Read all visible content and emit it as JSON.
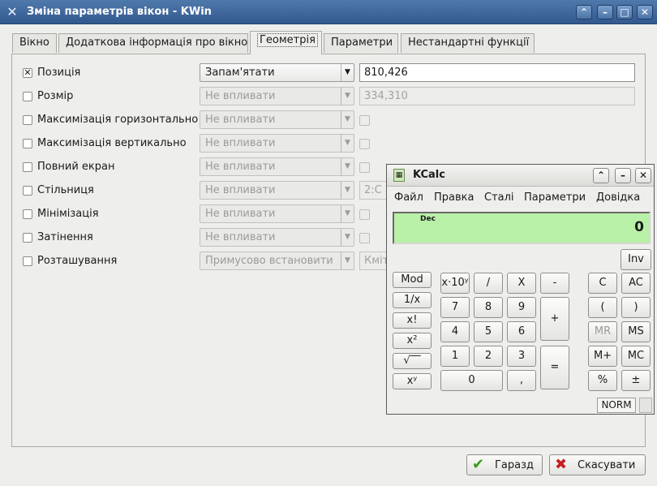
{
  "window": {
    "title": "Зміна параметрів вікон - KWin",
    "buttons": [
      "⌃",
      "–",
      "□",
      "✕"
    ]
  },
  "tabs": [
    {
      "label": "Вікно",
      "active": false
    },
    {
      "label": "Додаткова інформація про вікно",
      "active": false
    },
    {
      "label": "Геометрія",
      "active": true
    },
    {
      "label": "Параметри",
      "active": false
    },
    {
      "label": "Нестандартні функції",
      "active": false
    }
  ],
  "rows": [
    {
      "label": "Позиція",
      "checked": true,
      "select": "Запам'ятати",
      "select_enabled": true,
      "value": "810,426",
      "value_kind": "field"
    },
    {
      "label": "Розмір",
      "checked": false,
      "select": "Не впливати",
      "select_enabled": false,
      "value": "334,310",
      "value_kind": "field-disabled"
    },
    {
      "label": "Максимізація горизонтально",
      "checked": false,
      "select": "Не впливати",
      "select_enabled": false,
      "value_kind": "checkbox"
    },
    {
      "label": "Максимізація вертикально",
      "checked": false,
      "select": "Не впливати",
      "select_enabled": false,
      "value_kind": "checkbox"
    },
    {
      "label": "Повний екран",
      "checked": false,
      "select": "Не впливати",
      "select_enabled": false,
      "value_kind": "checkbox"
    },
    {
      "label": "Стільниця",
      "checked": false,
      "select": "Не впливати",
      "select_enabled": false,
      "value": "2:С",
      "value_kind": "short"
    },
    {
      "label": "Мінімізація",
      "checked": false,
      "select": "Не впливати",
      "select_enabled": false,
      "value_kind": "checkbox"
    },
    {
      "label": "Затінення",
      "checked": false,
      "select": "Не впливати",
      "select_enabled": false,
      "value_kind": "checkbox"
    },
    {
      "label": "Розташування",
      "checked": false,
      "select": "Примусово встановити",
      "select_enabled": false,
      "value": "Кміт",
      "value_kind": "short"
    }
  ],
  "dialog_buttons": {
    "ok": {
      "label": "Гаразд",
      "icon": "checkmark-icon",
      "color": "#3a9a1c"
    },
    "cancel": {
      "label": "Скасувати",
      "icon": "cross-icon",
      "color": "#c42020"
    }
  },
  "kcalc": {
    "title": "KCalc",
    "menu": [
      "Файл",
      "Правка",
      "Сталі",
      "Параметри",
      "Довідка"
    ],
    "title_buttons": [
      "⌃",
      "–",
      "✕"
    ],
    "display": {
      "base": "Dec",
      "value": "0",
      "bg": "#b8f0a8"
    },
    "inv": "Inv",
    "left_buttons": [
      "Mod",
      "1/x",
      "x!",
      "x²",
      "√‾‾",
      "xʸ"
    ],
    "keys": {
      "x10y": "x·10ʸ",
      "div": "/",
      "mul": "X",
      "sub": "-",
      "add": "+",
      "eq": "=",
      "d7": "7",
      "d8": "8",
      "d9": "9",
      "d4": "4",
      "d5": "5",
      "d6": "6",
      "d1": "1",
      "d2": "2",
      "d3": "3",
      "d0": "0",
      "dot": ",",
      "c": "C",
      "ac": "AC",
      "lparen": "(",
      "rparen": ")",
      "mr": "MR",
      "ms": "MS",
      "mplus": "M+",
      "mc": "MC",
      "pct": "%",
      "pm": "±"
    },
    "status": "NORM"
  }
}
